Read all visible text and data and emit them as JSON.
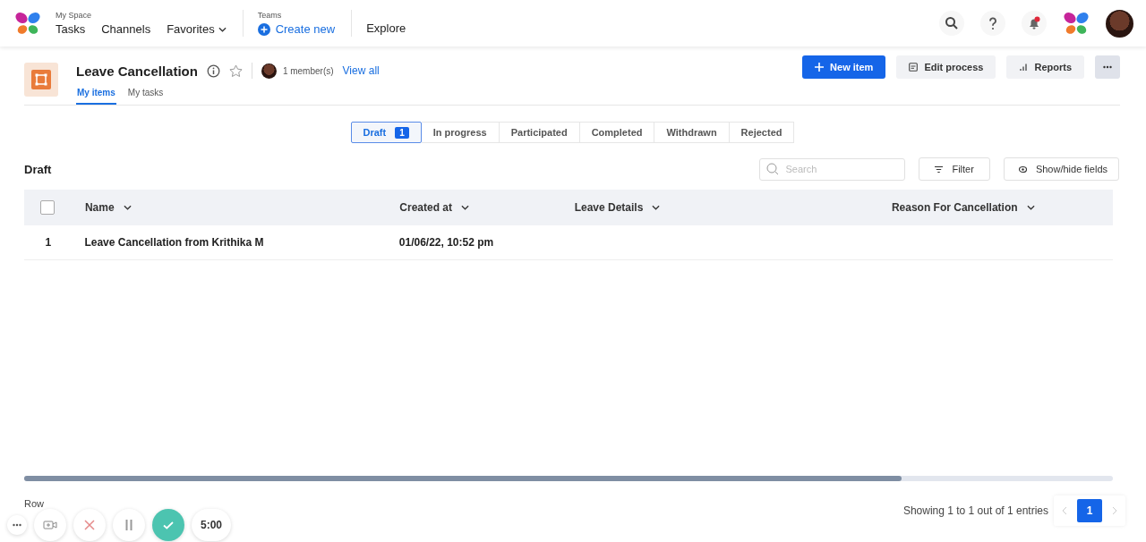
{
  "topbar": {
    "my_space_label": "My Space",
    "nav": [
      {
        "label": "Tasks",
        "kind": "link"
      },
      {
        "label": "Channels",
        "kind": "link"
      },
      {
        "label": "Favorites",
        "kind": "dropdown"
      }
    ],
    "teams_label": "Teams",
    "create_new": "Create new",
    "explore": "Explore",
    "notification_dot": true
  },
  "process": {
    "title": "Leave Cancellation",
    "members": "1 member(s)",
    "view_all": "View all",
    "tabs": [
      {
        "label": "My items",
        "selected": true
      },
      {
        "label": "My tasks",
        "selected": false
      }
    ],
    "actions": [
      {
        "label": "New item",
        "kind": "primary"
      },
      {
        "label": "Edit process",
        "kind": "edit"
      },
      {
        "label": "Reports",
        "kind": "reports"
      },
      {
        "kind": "more"
      }
    ]
  },
  "status_tabs": [
    {
      "label": "Draft",
      "count": "1",
      "selected": true
    },
    {
      "label": "In progress",
      "selected": false
    },
    {
      "label": "Participated",
      "selected": false
    },
    {
      "label": "Completed",
      "selected": false
    },
    {
      "label": "Withdrawn",
      "selected": false
    },
    {
      "label": "Rejected",
      "selected": false
    }
  ],
  "section_title": "Draft",
  "search": {
    "placeholder": "Search"
  },
  "filter": "Filter",
  "show_hide": "Show/hide fields",
  "table": {
    "select_all_checked": false,
    "columns": [
      "Name",
      "Created at",
      "Leave Details",
      "Reason For Cancellation"
    ],
    "rows": [
      {
        "index": "1",
        "name": "Leave Cancellation from Krithika M",
        "created_at": "01/06/22, 10:52 pm"
      }
    ]
  },
  "footer": {
    "rows_per_page_label": "Row",
    "summary": "Showing 1 to 1 out of 1 entries",
    "pages": [
      {
        "label": "1",
        "selected": true
      }
    ]
  },
  "recorder": {
    "timer": "5:00"
  }
}
